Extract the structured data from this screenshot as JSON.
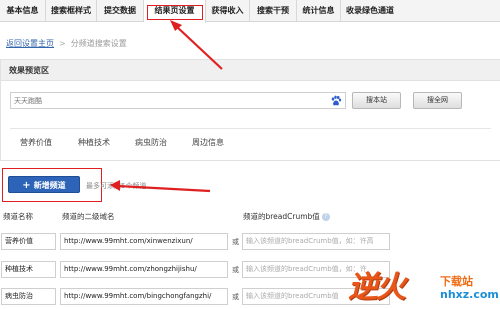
{
  "tabs": [
    {
      "label": "基本信息"
    },
    {
      "label": "搜索框样式"
    },
    {
      "label": "提交数据"
    },
    {
      "label": "结果页设置"
    },
    {
      "label": "获得收入"
    },
    {
      "label": "搜索干预"
    },
    {
      "label": "统计信息"
    },
    {
      "label": "收录绿色通道"
    }
  ],
  "breadcrumb": {
    "back_link": "返回设置主页",
    "separator": ">",
    "current": "分频道搜索设置"
  },
  "preview": {
    "heading": "效果预览区",
    "search_placeholder": "天天跑酷",
    "paw_icon": "baidu-paw-icon",
    "btn_site": "搜本站",
    "btn_all": "搜全网",
    "channels": [
      "营养价值",
      "种植技术",
      "病虫防治",
      "周边信息"
    ]
  },
  "add_channel": {
    "plus": "+",
    "label": "新增频道",
    "hint": "最多可添加5个频道"
  },
  "table": {
    "col_name": "频道名称",
    "col_domain": "频道的二级域名",
    "col_breadcrumb": "频道的breadCrumb值",
    "help_icon": "?",
    "or_text": "或",
    "rows": [
      {
        "name": "营养价值",
        "url": "http://www.99mht.com/xinwenzixun/",
        "breadcrumb_placeholder": "输入该频道的breadCrumb值，如：许高"
      },
      {
        "name": "种植技术",
        "url": "http://www.99mht.com/zhongzhijishu/",
        "breadcrumb_placeholder": "输入该频道的breadCrumb值，如：许"
      },
      {
        "name": "病虫防治",
        "url": "http://www.99mht.com/bingchongfangzhi/",
        "breadcrumb_placeholder": "输入该频道的breadCrumb值"
      }
    ]
  },
  "watermark": {
    "logo_text": "逆火",
    "top_text": "下载站",
    "bottom_text": "nhxz.com"
  },
  "colors": {
    "accent_blue": "#2d64b8",
    "highlight_red": "#e02020",
    "link_blue": "#3366aa"
  }
}
